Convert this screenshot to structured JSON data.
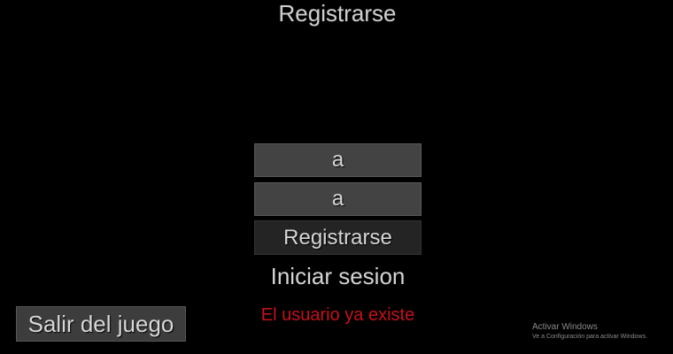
{
  "screen": {
    "title": "Registrarse"
  },
  "form": {
    "username_value": "a",
    "password_value": "a",
    "register_button_label": "Registrarse",
    "login_link_label": "Iniciar sesion",
    "error_message": "El usuario ya existe"
  },
  "exit_button_label": "Salir del juego",
  "windows_watermark": {
    "title": "Activar Windows",
    "subtitle": "Ve a Configuración para activar Windows."
  },
  "colors": {
    "background": "#000000",
    "field_background": "#434343",
    "register_button_background": "#242424",
    "exit_button_background": "#3d3d3d",
    "text": "#d0d0d0",
    "error": "#c8101a"
  }
}
